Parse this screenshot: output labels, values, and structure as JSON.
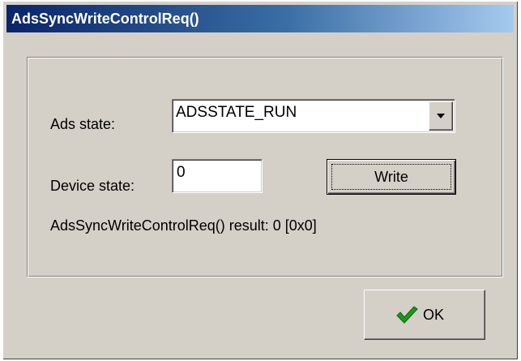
{
  "window": {
    "title": "AdsSyncWriteControlReq()"
  },
  "form": {
    "ads_state_label": "Ads state:",
    "ads_state_value": "ADSSTATE_RUN",
    "device_state_label": "Device state:",
    "device_state_value": "0",
    "write_label": "Write",
    "result_text": "AdsSyncWriteControlReq() result: 0 [0x0]"
  },
  "footer": {
    "ok_label": "OK"
  },
  "icons": {
    "dropdown": "chevron-down-icon",
    "ok": "checkmark-icon"
  },
  "colors": {
    "title_bar_start": "#0a246a",
    "title_bar_end": "#a6caf0",
    "face": "#d4d0c8",
    "checkmark": "#1a9a1a"
  }
}
